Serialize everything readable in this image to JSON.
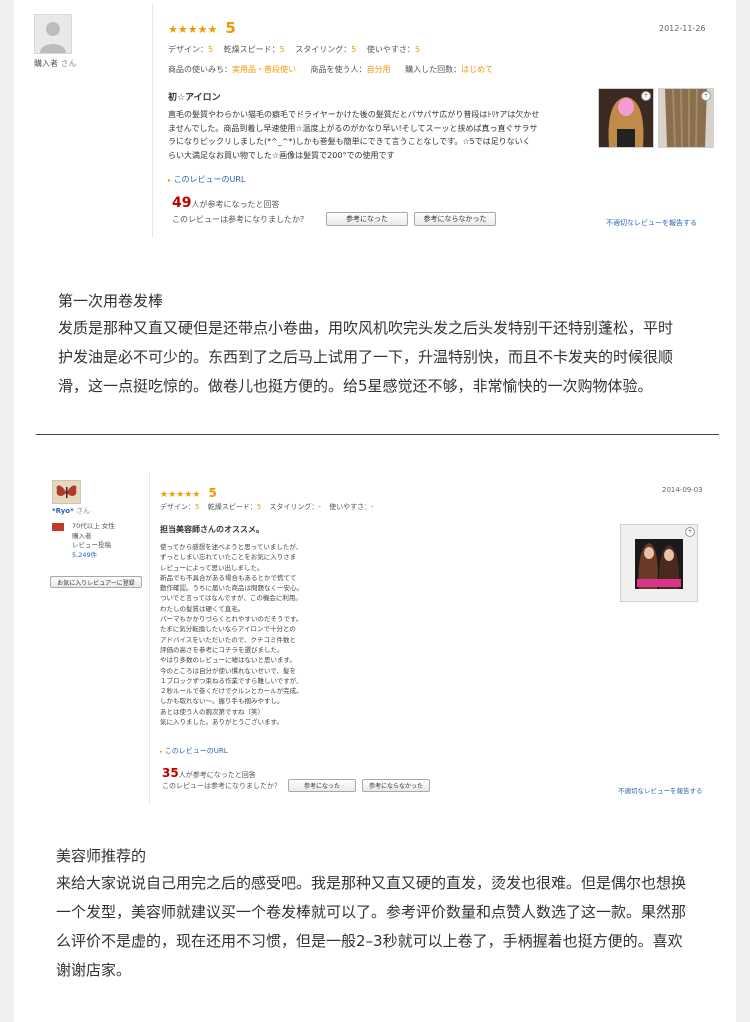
{
  "review1": {
    "stars": "★★★★★",
    "rating": "5",
    "date": "2012-11-26",
    "reviewer_label": "購入者",
    "reviewer_suffix": "さん",
    "metrics": [
      {
        "label": "デザイン：",
        "value": "5"
      },
      {
        "label": "乾燥スピード：",
        "value": "5"
      },
      {
        "label": "スタイリング：",
        "value": "5"
      },
      {
        "label": "使いやすさ：",
        "value": "5"
      }
    ],
    "usage_label": "商品の使いみち：",
    "usage_value": "実用品・普段使い",
    "user_label": "商品を使う人：",
    "user_value": "自分用",
    "count_label": "購入した回数：",
    "count_value": "はじめて",
    "title": "初☆アイロン",
    "body": [
      "直毛の髪質やわらかい猫毛の癖毛でドライヤーかけた後の髪質だとパサパサ広がり普段はﾄﾘｹアは欠かせ",
      "ませんでした。商品到着し早速使用☆温度上がるのがかなり早い!そしてスーッと挟めば真っ直ぐサラサ",
      "ラになりビックリしました(*^_^*)しかも巻髪も簡単にできて言うことなしです。☆5では足りないく",
      "らい大満足なお買い物でした☆画像は髪質で200°での使用です"
    ],
    "url_text": "このレビューのURL",
    "helpful_count": "49",
    "helpful_suffix": "人が参考になったと回答",
    "question": "このレビューは参考になりましたか？",
    "btn_yes": "参考になった",
    "btn_no": "参考にならなかった",
    "report": "不適切なレビューを報告する"
  },
  "translation1": {
    "title": "第一次用卷发棒",
    "lines": [
      "发质是那种又直又硬但是还带点小卷曲，用吹风机吹完头发之后头发特别干还特别蓬松，平时",
      "护发油是必不可少的。东西到了之后马上试用了一下，升温特别快，而且不卡发夹的时候很顺",
      "滑，这一点挺吃惊的。做卷儿也挺方便的。给5星感觉还不够，非常愉快的一次购物体验。"
    ]
  },
  "review2": {
    "stars": "★★★★★",
    "rating": "5",
    "date": "2014-09-03",
    "reviewer_name": "*Ryo*",
    "reviewer_suffix": "さん",
    "profile": [
      "70代以上 女性",
      "購入者",
      "レビュー投稿",
      "5,249件"
    ],
    "register_btn": "お気に入りレビュアーに登録",
    "metrics": [
      {
        "label": "デザイン：",
        "value": "5"
      },
      {
        "label": "乾燥スピード：",
        "value": "5"
      },
      {
        "label": "スタイリング：",
        "value": "-"
      },
      {
        "label": "使いやすさ：",
        "value": "-"
      }
    ],
    "title": "担当美容師さんのオススメ。",
    "body": [
      "使ってから感想を述べようと思っていましたが、",
      "ずっとしまい忘れていたことをお気に入りさま",
      "レビューによって思い出しました。",
      "新品でも不具合がある場合もあるとかで慌てて",
      "動作確認。うちに届いた商品は問題なく一安心。",
      "ついでと言ってはなんですが、この機会に利用。",
      "わたしの髪質は硬くて直毛。",
      "パーマもかかりづらくとれやすいのだそうです。",
      "たまに気分転換したいならアイロンで十分との",
      "アドバイスをいただいたので、クチコミ件数と",
      "評価の高さを参考にコチラを選びました。",
      "やはり多数のレビューに嘘はないと思います。",
      "今のところは自分が使い慣れないせいで、髪を",
      "１ブロックずつ束ねる作業ですら難しいですが、",
      "２秒ルールで巻くだけでクルンとカールが完成。",
      "しかも取れない～。握り手も掴みやすし。",
      "あとは使う人の腕次第ですね（笑）",
      "気に入りました。ありがとうございます。"
    ],
    "url_text": "このレビューのURL",
    "helpful_count": "35",
    "helpful_suffix": "人が参考になったと回答",
    "question": "このレビューは参考になりましたか？",
    "btn_yes": "参考になった",
    "btn_no": "参考にならなかった",
    "report": "不適切なレビューを報告する"
  },
  "translation2": {
    "title": "美容师推荐的",
    "lines": [
      "来给大家说说自己用完之后的感受吧。我是那种又直又硬的直发，烫发也很难。但是偶尔也想换",
      "一个发型，美容师就建议买一个卷发棒就可以了。参考评价数量和点赞人数选了这一款。果然那",
      "么评价不是虚的，现在还用不习惯，但是一般2–3秒就可以上卷了，手柄握着也挺方便的。喜欢",
      "谢谢店家。"
    ]
  }
}
